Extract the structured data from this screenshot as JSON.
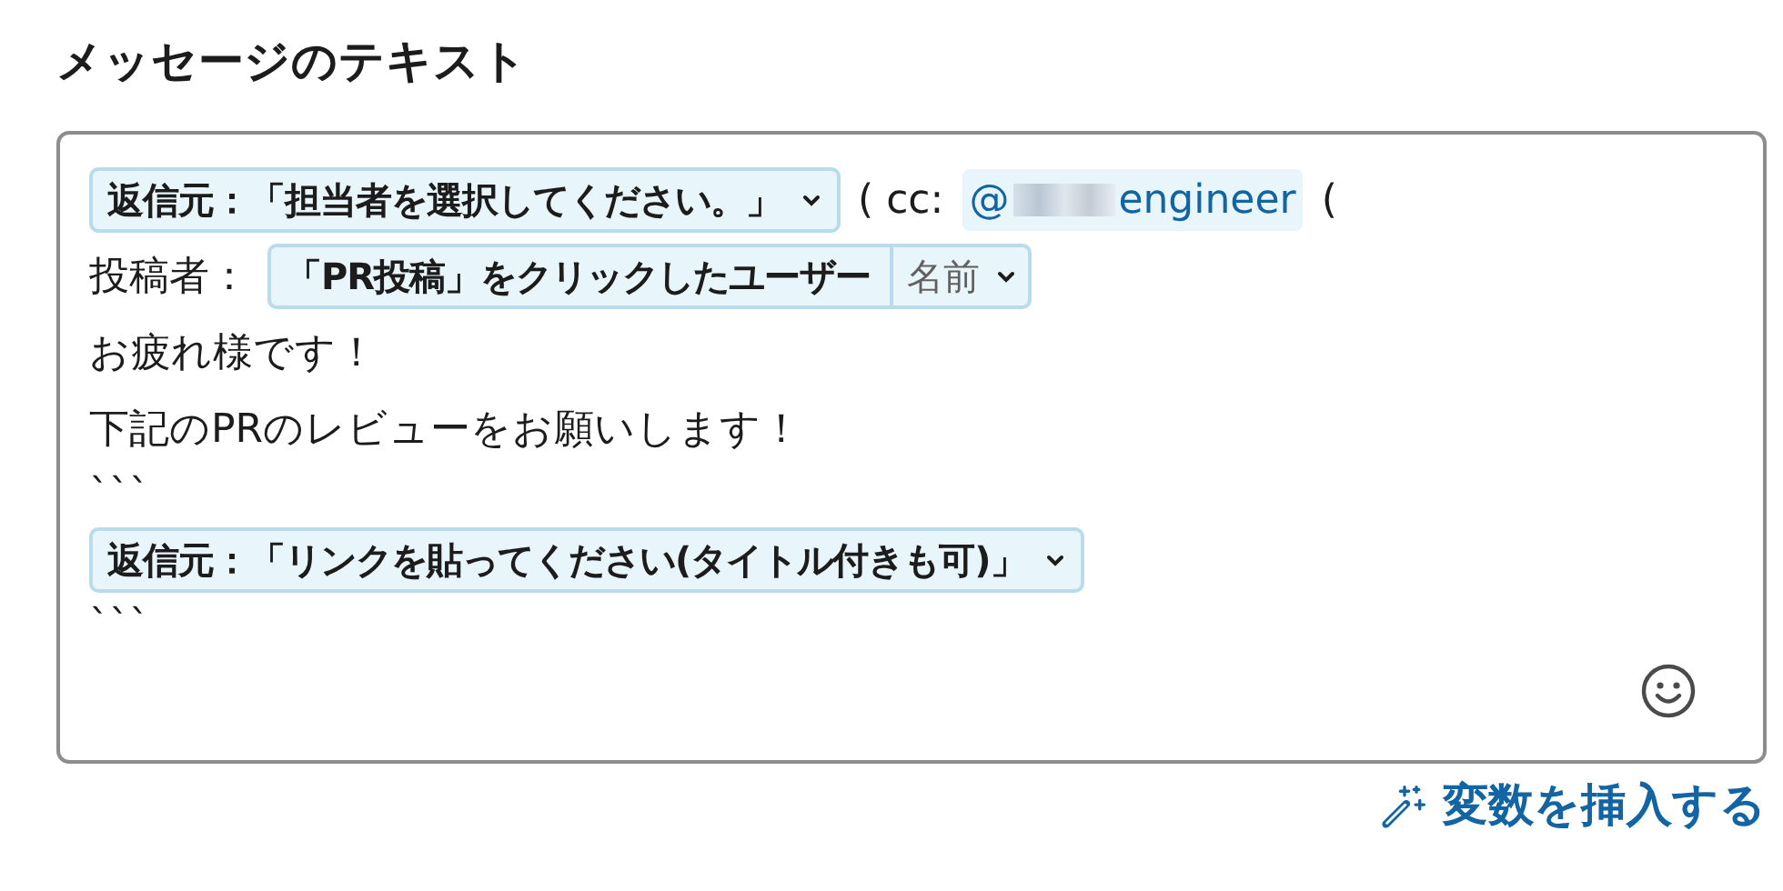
{
  "title": "メッセージのテキスト",
  "editor": {
    "lines": [
      {
        "segments": [
          {
            "kind": "variable",
            "label": "返信元：「担当者を選択してください。」"
          },
          {
            "kind": "text",
            "text": "( cc:"
          },
          {
            "kind": "mention",
            "prefix": "@",
            "suffix": "engineer"
          },
          {
            "kind": "text",
            "text": "("
          }
        ]
      },
      {
        "segments": [
          {
            "kind": "text",
            "text": "投稿者："
          },
          {
            "kind": "variable",
            "label": "「PR投稿」をクリックしたユーザー",
            "field": "名前"
          }
        ]
      },
      {
        "segments": [
          {
            "kind": "text",
            "text": "お疲れ様です！"
          }
        ]
      },
      {
        "segments": [
          {
            "kind": "text",
            "text": "下記のPRのレビューをお願いします！"
          }
        ]
      },
      {
        "segments": [
          {
            "kind": "text",
            "text": "```"
          }
        ]
      },
      {
        "segments": [
          {
            "kind": "variable",
            "label": "返信元：「リンクを貼ってください(タイトル付きも可)」"
          }
        ]
      },
      {
        "segments": [
          {
            "kind": "text",
            "text": "```"
          }
        ]
      }
    ]
  },
  "insert_link": "変数を挿入する"
}
